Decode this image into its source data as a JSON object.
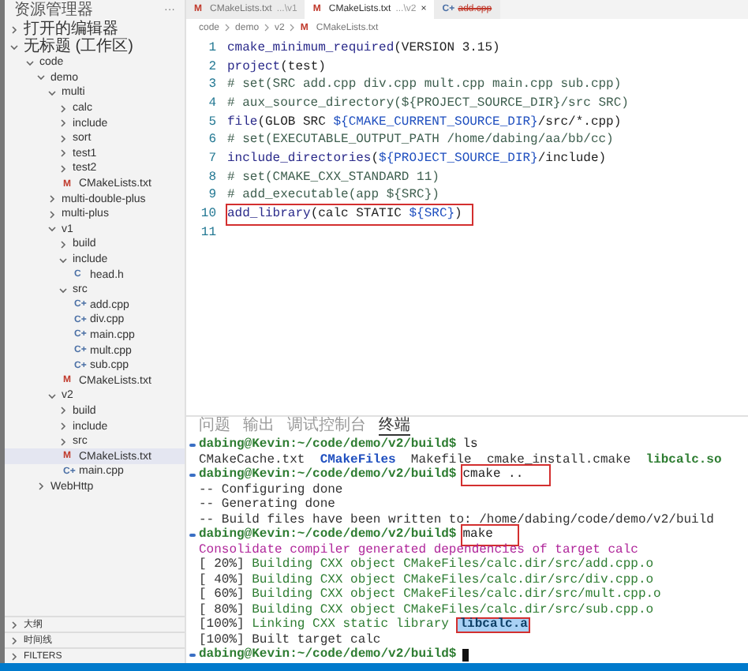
{
  "sidebar": {
    "title": "资源管理器",
    "more": "···",
    "sections": [
      {
        "label": "打开的编辑器",
        "expanded": false
      },
      {
        "label": "无标题 (工作区)",
        "expanded": true
      }
    ],
    "tree": [
      {
        "label": "code",
        "kind": "folder",
        "expanded": true,
        "selected": false,
        "children": [
          {
            "label": "demo",
            "kind": "folder",
            "expanded": true,
            "selected": false,
            "children": [
              {
                "label": "multi",
                "kind": "folder",
                "expanded": true,
                "selected": false,
                "children": [
                  {
                    "label": "calc",
                    "kind": "folder",
                    "expanded": false,
                    "selected": false
                  },
                  {
                    "label": "include",
                    "kind": "folder",
                    "expanded": false,
                    "selected": false
                  },
                  {
                    "label": "sort",
                    "kind": "folder",
                    "expanded": false,
                    "selected": false
                  },
                  {
                    "label": "test1",
                    "kind": "folder",
                    "expanded": false,
                    "selected": false
                  },
                  {
                    "label": "test2",
                    "kind": "folder",
                    "expanded": false,
                    "selected": false
                  },
                  {
                    "label": "CMakeLists.txt",
                    "kind": "file",
                    "icon": "M",
                    "selected": false
                  }
                ]
              },
              {
                "label": "multi-double-plus",
                "kind": "folder",
                "expanded": false,
                "selected": false
              },
              {
                "label": "multi-plus",
                "kind": "folder",
                "expanded": false,
                "selected": false
              },
              {
                "label": "v1",
                "kind": "folder",
                "expanded": true,
                "selected": false,
                "children": [
                  {
                    "label": "build",
                    "kind": "folder",
                    "expanded": false,
                    "selected": false
                  },
                  {
                    "label": "include",
                    "kind": "folder",
                    "expanded": true,
                    "selected": false,
                    "children": [
                      {
                        "label": "head.h",
                        "kind": "file",
                        "icon": "C",
                        "selected": false
                      }
                    ]
                  },
                  {
                    "label": "src",
                    "kind": "folder",
                    "expanded": true,
                    "selected": false,
                    "children": [
                      {
                        "label": "add.cpp",
                        "kind": "file",
                        "icon": "C+",
                        "selected": false
                      },
                      {
                        "label": "div.cpp",
                        "kind": "file",
                        "icon": "C+",
                        "selected": false
                      },
                      {
                        "label": "main.cpp",
                        "kind": "file",
                        "icon": "C+",
                        "selected": false
                      },
                      {
                        "label": "mult.cpp",
                        "kind": "file",
                        "icon": "C+",
                        "selected": false
                      },
                      {
                        "label": "sub.cpp",
                        "kind": "file",
                        "icon": "C+",
                        "selected": false
                      }
                    ]
                  },
                  {
                    "label": "CMakeLists.txt",
                    "kind": "file",
                    "icon": "M",
                    "selected": false
                  }
                ]
              },
              {
                "label": "v2",
                "kind": "folder",
                "expanded": true,
                "selected": false,
                "children": [
                  {
                    "label": "build",
                    "kind": "folder",
                    "expanded": false,
                    "selected": false
                  },
                  {
                    "label": "include",
                    "kind": "folder",
                    "expanded": false,
                    "selected": false
                  },
                  {
                    "label": "src",
                    "kind": "folder",
                    "expanded": false,
                    "selected": false
                  },
                  {
                    "label": "CMakeLists.txt",
                    "kind": "file",
                    "icon": "M",
                    "selected": true
                  },
                  {
                    "label": "main.cpp",
                    "kind": "file",
                    "icon": "C+",
                    "selected": false
                  }
                ]
              }
            ]
          },
          {
            "label": "WebHttp",
            "kind": "folder",
            "expanded": false,
            "selected": false
          }
        ]
      }
    ],
    "bottom_sections": [
      {
        "label": "大纲",
        "expanded": false
      },
      {
        "label": "时间线",
        "expanded": false
      },
      {
        "label": "FILTERS",
        "expanded": false
      }
    ]
  },
  "tabs": [
    {
      "icon": "M",
      "label": "CMakeLists.txt",
      "hint": "...\\v1",
      "selected": false
    },
    {
      "icon": "M",
      "label": "CMakeLists.txt",
      "hint": "...\\v2",
      "selected": true,
      "close": "×"
    },
    {
      "icon": "C+",
      "label": "add.cpp",
      "selected": false
    }
  ],
  "breadcrumb": [
    "code",
    "demo",
    "v2",
    "CMakeLists.txt"
  ],
  "breadcrumb_icon": "M",
  "code_lines": [
    {
      "number": "1",
      "boxed": false,
      "segments": [
        {
          "text": "cmake_minimum_required",
          "color": "#2a2a8a"
        },
        {
          "text": "(VERSION 3.15)",
          "color": "#222222"
        }
      ]
    },
    {
      "number": "2",
      "boxed": false,
      "segments": [
        {
          "text": "project",
          "color": "#2a2a8a"
        },
        {
          "text": "(test)",
          "color": "#222222"
        }
      ]
    },
    {
      "number": "3",
      "boxed": false,
      "segments": [
        {
          "text": "# set(SRC add.cpp div.cpp mult.cpp main.cpp sub.cpp)",
          "color": "#3f5f4f"
        }
      ]
    },
    {
      "number": "4",
      "boxed": false,
      "segments": [
        {
          "text": "# aux_source_directory(${PROJECT_SOURCE_DIR}/src SRC)",
          "color": "#3f5f4f"
        }
      ]
    },
    {
      "number": "5",
      "boxed": false,
      "segments": [
        {
          "text": "file",
          "color": "#2a2a8a"
        },
        {
          "text": "(GLOB SRC ",
          "color": "#222222"
        },
        {
          "text": "${CMAKE_CURRENT_SOURCE_DIR}",
          "color": "#1f4fbf"
        },
        {
          "text": "/src/*.cpp)",
          "color": "#222222"
        }
      ]
    },
    {
      "number": "6",
      "boxed": false,
      "segments": [
        {
          "text": "# set(EXECUTABLE_OUTPUT_PATH /home/dabing/aa/bb/cc)",
          "color": "#3f5f4f"
        }
      ]
    },
    {
      "number": "7",
      "boxed": false,
      "segments": [
        {
          "text": "include_directories",
          "color": "#2a2a8a"
        },
        {
          "text": "(",
          "color": "#222222"
        },
        {
          "text": "${PROJECT_SOURCE_DIR}",
          "color": "#1f4fbf"
        },
        {
          "text": "/include)",
          "color": "#222222"
        }
      ]
    },
    {
      "number": "8",
      "boxed": false,
      "segments": [
        {
          "text": "# set(CMAKE_CXX_STANDARD 11)",
          "color": "#3f5f4f"
        }
      ]
    },
    {
      "number": "9",
      "boxed": false,
      "segments": [
        {
          "text": "# add_executable(app ${SRC})",
          "color": "#3f5f4f"
        }
      ]
    },
    {
      "number": "10",
      "boxed": true,
      "segments": [
        {
          "text": "add_library",
          "color": "#2a2a8a"
        },
        {
          "text": "(calc STATIC ",
          "color": "#222222"
        },
        {
          "text": "${SRC}",
          "color": "#1f4fbf"
        },
        {
          "text": ")",
          "color": "#222222"
        }
      ]
    },
    {
      "number": "11",
      "boxed": false
    }
  ],
  "panel_tabs": [
    {
      "label": "问题",
      "selected": false
    },
    {
      "label": "输出",
      "selected": false
    },
    {
      "label": "调试控制台",
      "selected": false
    },
    {
      "label": "终端",
      "selected": true
    }
  ],
  "terminal": [
    {
      "kind": "prompt",
      "prompt": "dabing@Kevin:~/code/demo/v2/build$",
      "command": "ls",
      "boxed": false
    },
    {
      "kind": "output",
      "segments": [
        {
          "text": "CMakeCache.txt  ",
          "color": "#333333",
          "bold": false
        },
        {
          "text": "CMakeFiles",
          "color": "#1f4fbf",
          "bold": true
        },
        {
          "text": "  Makefile  cmake_install.cmake  ",
          "color": "#333333",
          "bold": false
        },
        {
          "text": "libcalc.so",
          "color": "#2e7d32",
          "bold": true
        }
      ]
    },
    {
      "kind": "prompt",
      "prompt": "dabing@Kevin:~/code/demo/v2/build$",
      "command": "cmake ..",
      "boxed": true
    },
    {
      "kind": "output",
      "segments": [
        {
          "text": "-- Configuring done",
          "color": "#333333",
          "bold": false
        }
      ]
    },
    {
      "kind": "output",
      "segments": [
        {
          "text": "-- Generating done",
          "color": "#333333",
          "bold": false
        }
      ]
    },
    {
      "kind": "output",
      "segments": [
        {
          "text": "-- Build files have been written to: /home/dabing/code/demo/v2/build",
          "color": "#333333",
          "bold": false
        }
      ]
    },
    {
      "kind": "prompt",
      "prompt": "dabing@Kevin:~/code/demo/v2/build$",
      "command": "make",
      "boxed": true
    },
    {
      "kind": "output",
      "segments": [
        {
          "text": "Consolidate compiler generated dependencies of target calc",
          "color": "#b0279b",
          "bold": false
        }
      ]
    },
    {
      "kind": "output",
      "segments": [
        {
          "text": "[ 20%] ",
          "color": "#333333",
          "bold": false
        },
        {
          "text": "Building CXX object CMakeFiles/calc.dir/src/add.cpp.o",
          "color": "#2e7d32",
          "bold": false
        }
      ]
    },
    {
      "kind": "output",
      "segments": [
        {
          "text": "[ 40%] ",
          "color": "#333333",
          "bold": false
        },
        {
          "text": "Building CXX object CMakeFiles/calc.dir/src/div.cpp.o",
          "color": "#2e7d32",
          "bold": false
        }
      ]
    },
    {
      "kind": "output",
      "segments": [
        {
          "text": "[ 60%] ",
          "color": "#333333",
          "bold": false
        },
        {
          "text": "Building CXX object CMakeFiles/calc.dir/src/mult.cpp.o",
          "color": "#2e7d32",
          "bold": false
        }
      ]
    },
    {
      "kind": "output",
      "segments": [
        {
          "text": "[ 80%] ",
          "color": "#333333",
          "bold": false
        },
        {
          "text": "Building CXX object CMakeFiles/calc.dir/src/sub.cpp.o",
          "color": "#2e7d32",
          "bold": false
        }
      ]
    },
    {
      "kind": "output",
      "segments": [
        {
          "text": "[100%] ",
          "color": "#333333",
          "bold": false
        },
        {
          "text": "Linking CXX static library ",
          "color": "#2e7d32",
          "bold": false
        },
        {
          "text": "libcalc.a",
          "bold": true,
          "boxed": true
        }
      ]
    },
    {
      "kind": "output",
      "segments": [
        {
          "text": "[100%] Built target calc",
          "color": "#333333",
          "bold": false
        }
      ]
    },
    {
      "kind": "prompt",
      "prompt": "dabing@Kevin:~/code/demo/v2/build$",
      "cursor": true
    }
  ]
}
